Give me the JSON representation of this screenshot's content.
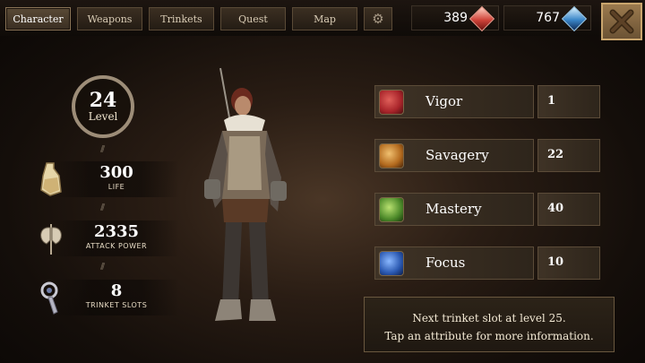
{
  "tabs": [
    {
      "label": "Character"
    },
    {
      "label": "Weapons"
    },
    {
      "label": "Trinkets"
    },
    {
      "label": "Quest"
    },
    {
      "label": "Map"
    }
  ],
  "currency": {
    "red_gems": "389",
    "blue_gems": "767"
  },
  "level": {
    "value": "24",
    "label": "Level"
  },
  "stats": [
    {
      "value": "300",
      "label": "LIFE",
      "icon": "flask-icon"
    },
    {
      "value": "2335",
      "label": "ATTACK POWER",
      "icon": "axe-icon"
    },
    {
      "value": "8",
      "label": "TRINKET SLOTS",
      "icon": "trinket-icon"
    }
  ],
  "attributes": [
    {
      "name": "Vigor",
      "value": "1",
      "color": "#a8242a"
    },
    {
      "name": "Savagery",
      "value": "22",
      "color": "#b36a1e"
    },
    {
      "name": "Mastery",
      "value": "40",
      "color": "#4d8a2a"
    },
    {
      "name": "Focus",
      "value": "10",
      "color": "#2a58b0"
    }
  ],
  "info": {
    "line1": "Next trinket slot at level 25.",
    "line2": "Tap an attribute for more information."
  }
}
